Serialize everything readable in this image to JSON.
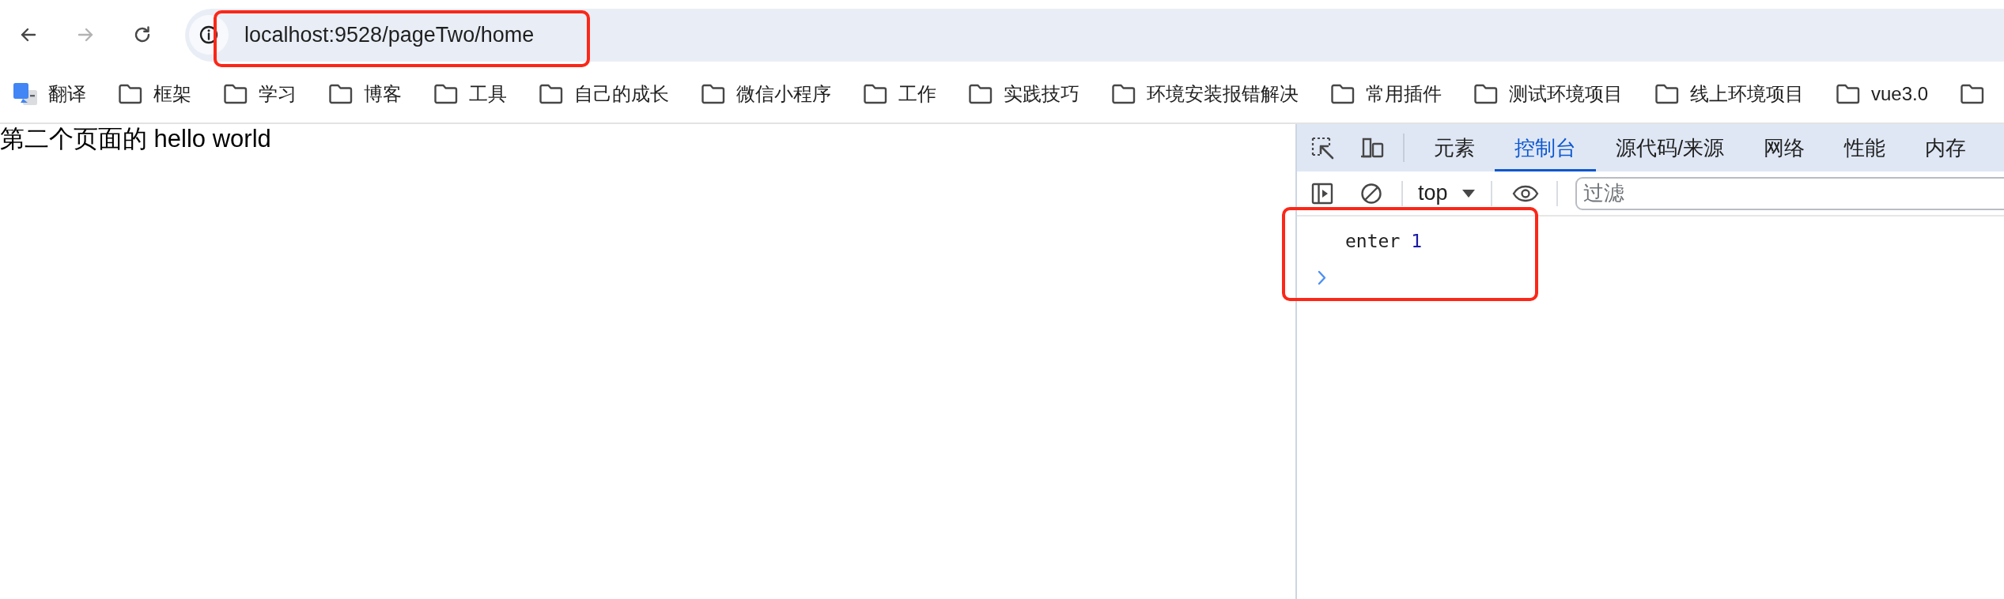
{
  "toolbar": {
    "nav_buttons": [
      {
        "kind": "back",
        "disabled": false
      },
      {
        "kind": "forward",
        "disabled": true
      },
      {
        "kind": "reload",
        "disabled": false
      }
    ],
    "address_bar": {
      "value": "localhost:9528/pageTwo/home",
      "highlighted": true
    }
  },
  "bookmarks": [
    {
      "kind": "app",
      "label": "翻译"
    },
    {
      "kind": "folder",
      "label": "框架"
    },
    {
      "kind": "folder",
      "label": "学习"
    },
    {
      "kind": "folder",
      "label": "博客"
    },
    {
      "kind": "folder",
      "label": "工具"
    },
    {
      "kind": "folder",
      "label": "自己的成长"
    },
    {
      "kind": "folder",
      "label": "微信小程序"
    },
    {
      "kind": "folder",
      "label": "工作"
    },
    {
      "kind": "folder",
      "label": "实践技巧"
    },
    {
      "kind": "folder",
      "label": "环境安装报错解决"
    },
    {
      "kind": "folder",
      "label": "常用插件"
    },
    {
      "kind": "folder",
      "label": "测试环境项目"
    },
    {
      "kind": "folder",
      "label": "线上环境项目"
    },
    {
      "kind": "folder",
      "label": "vue3.0"
    },
    {
      "kind": "folder"
    }
  ],
  "page": {
    "text": "第二个页面的 hello world"
  },
  "devtools": {
    "tabs": [
      {
        "label": "元素",
        "selected": false
      },
      {
        "label": "控制台",
        "selected": true
      },
      {
        "label": "源代码/来源",
        "selected": false
      },
      {
        "label": "网络",
        "selected": false
      },
      {
        "label": "性能",
        "selected": false
      },
      {
        "label": "内存",
        "selected": false
      }
    ],
    "console_toolbar": {
      "context": "top",
      "filter": {
        "placeholder": "过滤"
      }
    },
    "console": {
      "highlighted": true,
      "messages": [
        {
          "text": "enter",
          "value": "1"
        }
      ]
    }
  }
}
